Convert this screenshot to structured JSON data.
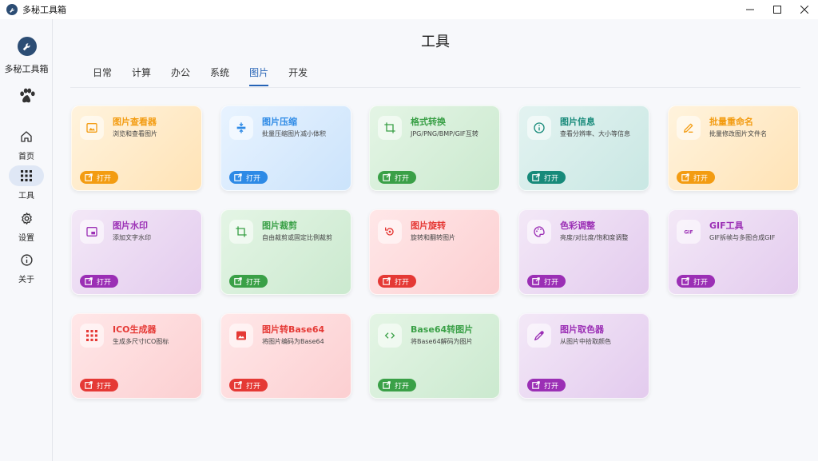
{
  "window": {
    "title": "多秘工具箱"
  },
  "sidebar": {
    "app_name": "多秘工具箱",
    "nav": [
      {
        "label": "首页",
        "icon": "home-icon"
      },
      {
        "label": "工具",
        "icon": "grid-icon",
        "active": true
      },
      {
        "label": "设置",
        "icon": "gear-icon"
      },
      {
        "label": "关于",
        "icon": "info-icon"
      }
    ]
  },
  "header": {
    "title": "工具"
  },
  "tabs": [
    {
      "label": "日常"
    },
    {
      "label": "计算"
    },
    {
      "label": "办公"
    },
    {
      "label": "系统"
    },
    {
      "label": "图片",
      "active": true
    },
    {
      "label": "开发"
    }
  ],
  "tools": [
    {
      "title": "图片查看器",
      "desc": "浏览和查看图片",
      "button": "打开",
      "icon": "image-icon",
      "theme": "orange",
      "accent": "#f39c12"
    },
    {
      "title": "图片压缩",
      "desc": "批量压缩图片减小体积",
      "button": "打开",
      "icon": "compress-icon",
      "theme": "blue",
      "accent": "#2d8ae6"
    },
    {
      "title": "格式转换",
      "desc": "JPG/PNG/BMP/GIF互转",
      "button": "打开",
      "icon": "crop-icon",
      "theme": "green",
      "accent": "#3aa047"
    },
    {
      "title": "图片信息",
      "desc": "查看分辨率、大小等信息",
      "button": "打开",
      "icon": "info-circle-icon",
      "theme": "teal",
      "accent": "#178a7a"
    },
    {
      "title": "批量重命名",
      "desc": "批量修改图片文件名",
      "button": "打开",
      "icon": "pencil-icon",
      "theme": "orange",
      "accent": "#f39c12"
    },
    {
      "title": "图片水印",
      "desc": "添加文字水印",
      "button": "打开",
      "icon": "watermark-icon",
      "theme": "purple",
      "accent": "#9b2fb5"
    },
    {
      "title": "图片裁剪",
      "desc": "自由裁剪或固定比例裁剪",
      "button": "打开",
      "icon": "crop-icon",
      "theme": "green",
      "accent": "#3aa047"
    },
    {
      "title": "图片旋转",
      "desc": "旋转和翻转图片",
      "button": "打开",
      "icon": "rotate-icon",
      "theme": "red",
      "accent": "#e53935"
    },
    {
      "title": "色彩调整",
      "desc": "亮度/对比度/饱和度调整",
      "button": "打开",
      "icon": "palette-icon",
      "theme": "purple",
      "accent": "#9b2fb5"
    },
    {
      "title": "GIF工具",
      "desc": "GIF拆帧与多图合成GIF",
      "button": "打开",
      "icon": "gif-icon",
      "theme": "purple",
      "accent": "#9b2fb5"
    },
    {
      "title": "ICO生成器",
      "desc": "生成多尺寸ICO图标",
      "button": "打开",
      "icon": "apps-grid-icon",
      "theme": "red",
      "accent": "#e53935"
    },
    {
      "title": "图片转Base64",
      "desc": "将图片编码为Base64",
      "button": "打开",
      "icon": "image-icon",
      "theme": "red",
      "accent": "#e53935"
    },
    {
      "title": "Base64转图片",
      "desc": "将Base64解码为图片",
      "button": "打开",
      "icon": "code-icon",
      "theme": "green",
      "accent": "#3aa047"
    },
    {
      "title": "图片取色器",
      "desc": "从图片中拾取颜色",
      "button": "打开",
      "icon": "eyedropper-icon",
      "theme": "purple",
      "accent": "#9b2fb5"
    }
  ]
}
